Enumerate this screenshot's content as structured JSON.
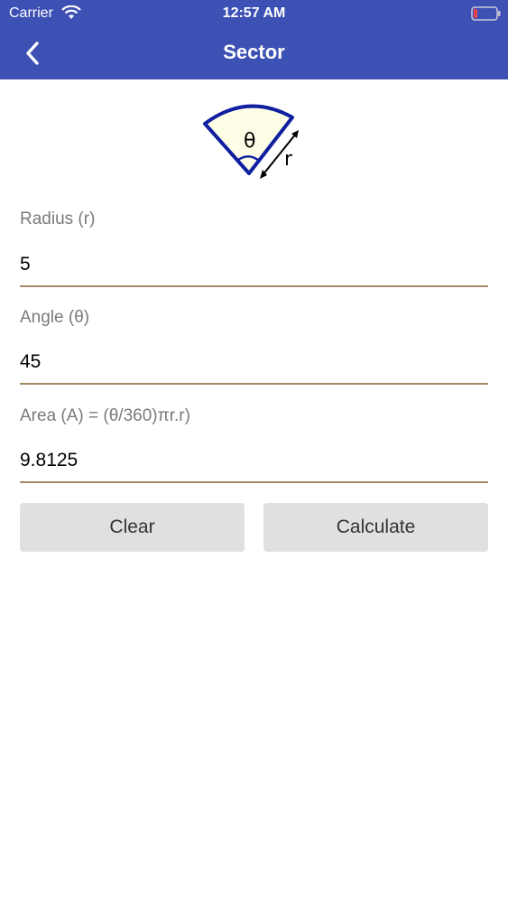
{
  "status": {
    "carrier": "Carrier",
    "time": "12:57 AM",
    "wifi_icon": "wifi-icon",
    "battery_icon": "battery-low-icon"
  },
  "nav": {
    "title": "Sector",
    "back_icon": "chevron-left-icon",
    "background_color": "#3d50b4"
  },
  "figure": {
    "theta_symbol": "θ",
    "radius_symbol": "r"
  },
  "form": {
    "radius_label": "Radius (r)",
    "radius_value": "5",
    "angle_label": "Angle (θ)",
    "angle_value": "45",
    "area_label": "Area (A) = (θ/360)πr.r)",
    "area_value": "9.8125",
    "underline_color": "#a38a62"
  },
  "buttons": {
    "clear_label": "Clear",
    "calculate_label": "Calculate"
  }
}
